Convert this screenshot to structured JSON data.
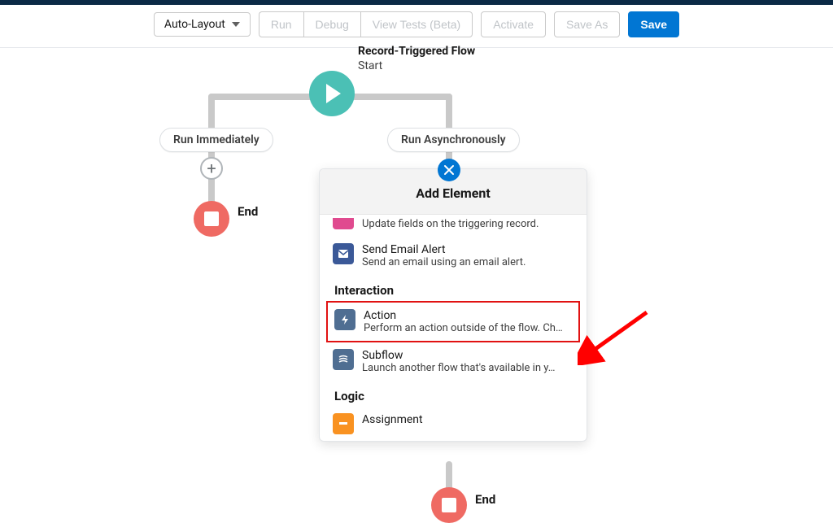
{
  "toolbar": {
    "layout_dropdown": "Auto-Layout",
    "run": "Run",
    "debug": "Debug",
    "view_tests": "View Tests (Beta)",
    "activate": "Activate",
    "save_as": "Save As",
    "save": "Save"
  },
  "flow": {
    "title": "Record-Triggered Flow",
    "subtitle": "Start",
    "branch_left": "Run Immediately",
    "branch_right": "Run Asynchronously",
    "end_left": "End",
    "end_bottom": "End"
  },
  "panel": {
    "header": "Add Element",
    "sections": [
      {
        "items": [
          {
            "icon": "edit-record-icon",
            "icon_class": "icon-pink",
            "title": "",
            "desc": "Update fields on the triggering record."
          },
          {
            "icon": "email-icon",
            "icon_class": "icon-darkblue",
            "title": "Send Email Alert",
            "desc": "Send an email using an email alert."
          }
        ]
      },
      {
        "heading": "Interaction",
        "items": [
          {
            "icon": "lightning-icon",
            "icon_class": "icon-slate",
            "title": "Action",
            "desc": "Perform an action outside of the flow. Ch…",
            "highlight": true
          },
          {
            "icon": "subflow-icon",
            "icon_class": "icon-steel",
            "title": "Subflow",
            "desc": "Launch another flow that's available in y…"
          }
        ]
      },
      {
        "heading": "Logic",
        "items": [
          {
            "icon": "assignment-icon",
            "icon_class": "icon-orange",
            "title": "Assignment",
            "desc": ""
          }
        ]
      }
    ]
  }
}
